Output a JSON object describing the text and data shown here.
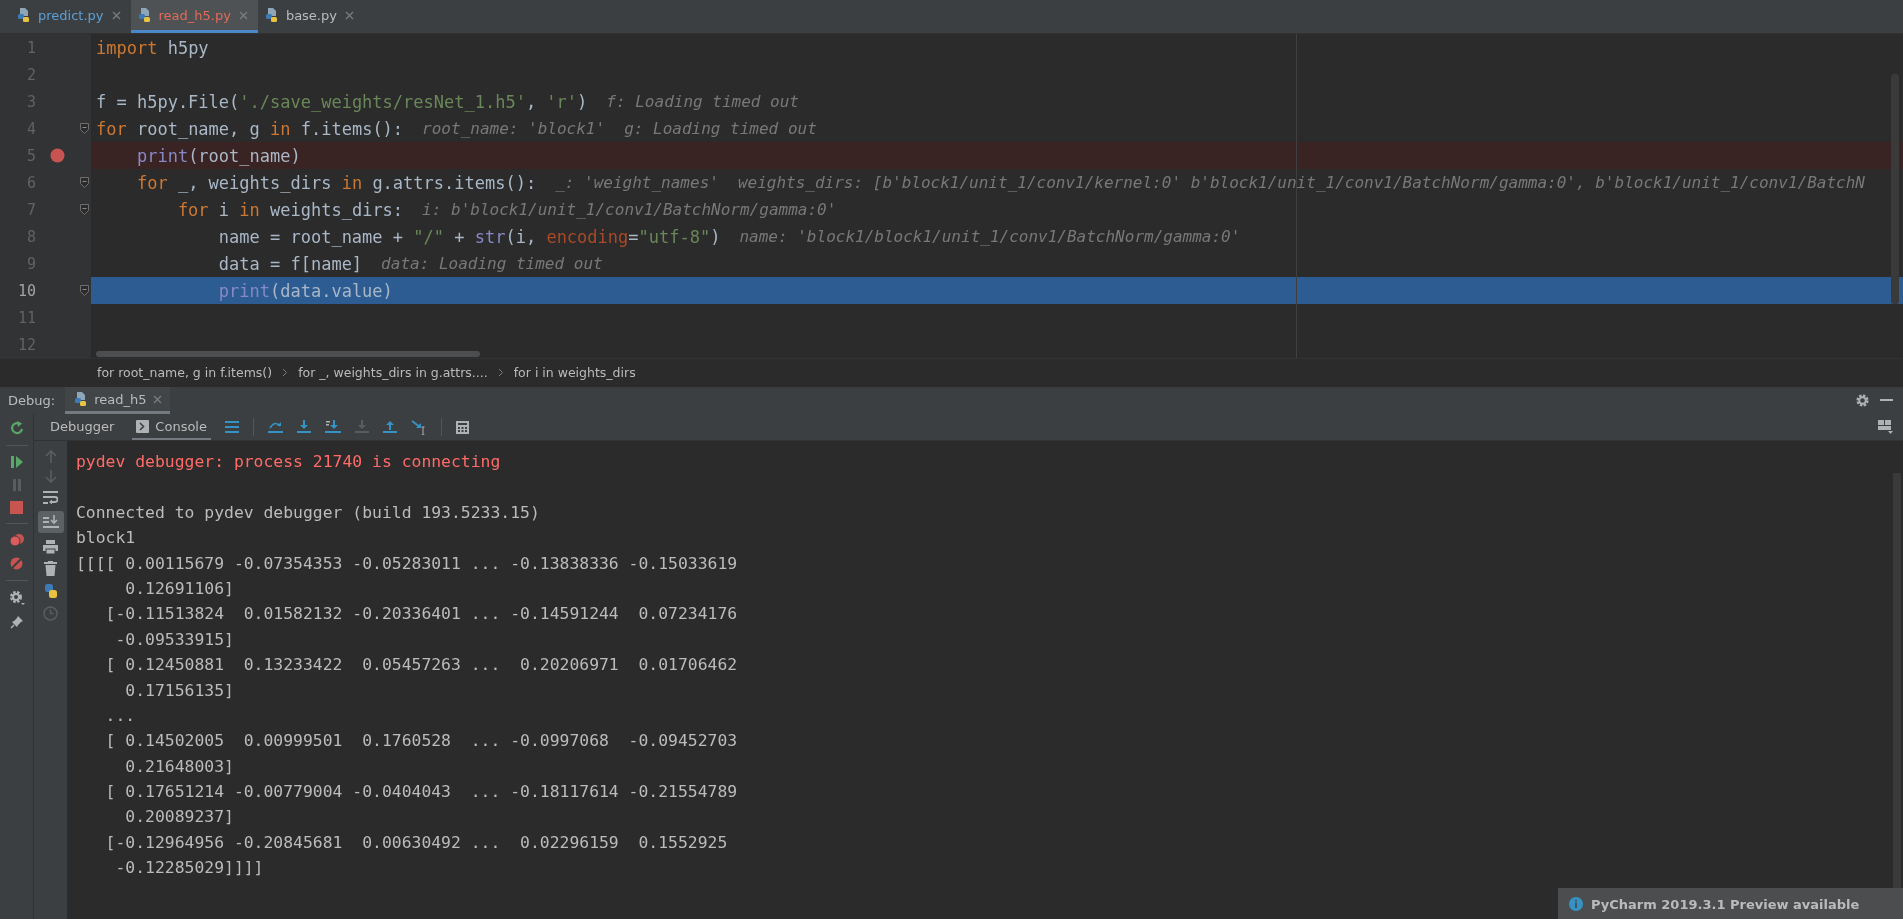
{
  "tabs": [
    {
      "label": "predict.py",
      "selected": false,
      "color": "#5c9fd6"
    },
    {
      "label": "read_h5.py",
      "selected": true,
      "color": "#e06c5a"
    },
    {
      "label": "base.py",
      "selected": false,
      "color": "#bbbbbb"
    }
  ],
  "editor": {
    "lines": [
      {
        "number": "1",
        "breakpoint": false,
        "current": false,
        "fold": false,
        "tokens": [
          {
            "kind": "keyword",
            "text": "import"
          },
          {
            "kind": "plain",
            "text": " h5py"
          }
        ]
      },
      {
        "number": "2",
        "breakpoint": false,
        "current": false,
        "fold": false
      },
      {
        "number": "3",
        "breakpoint": false,
        "current": false,
        "fold": false,
        "tokens": [
          {
            "kind": "plain",
            "text": "f = h5py.File("
          },
          {
            "kind": "string",
            "text": "'./save_weights/resNet_1.h5'"
          },
          {
            "kind": "plain",
            "text": ", "
          },
          {
            "kind": "string",
            "text": "'r'"
          },
          {
            "kind": "plain",
            "text": ")"
          }
        ],
        "hints": [
          "f: Loading timed out"
        ]
      },
      {
        "number": "4",
        "breakpoint": false,
        "current": false,
        "fold": true,
        "tokens": [
          {
            "kind": "keyword",
            "text": "for"
          },
          {
            "kind": "plain",
            "text": " root_name, g "
          },
          {
            "kind": "keyword",
            "text": "in"
          },
          {
            "kind": "plain",
            "text": " f.items():"
          }
        ],
        "hints": [
          "root_name: 'block1'",
          "g: Loading timed out"
        ]
      },
      {
        "number": "5",
        "breakpoint": true,
        "current": false,
        "fold": false,
        "tokens": [
          {
            "kind": "builtin",
            "text": "    print"
          },
          {
            "kind": "plain",
            "text": "(root_name)"
          }
        ]
      },
      {
        "number": "6",
        "breakpoint": false,
        "current": false,
        "fold": true,
        "tokens": [
          {
            "kind": "keyword",
            "text": "    for"
          },
          {
            "kind": "plain",
            "text": " _, weights_dirs "
          },
          {
            "kind": "keyword",
            "text": "in"
          },
          {
            "kind": "plain",
            "text": " g.attrs.items():"
          }
        ],
        "hints": [
          "_: 'weight_names'",
          "weights_dirs: [b'block1/unit_1/conv1/kernel:0' b'block1/unit_1/conv1/BatchNorm/gamma:0', b'block1/unit_1/conv1/BatchN"
        ]
      },
      {
        "number": "7",
        "breakpoint": false,
        "current": false,
        "fold": true,
        "tokens": [
          {
            "kind": "keyword",
            "text": "        for"
          },
          {
            "kind": "plain",
            "text": " i "
          },
          {
            "kind": "keyword",
            "text": "in"
          },
          {
            "kind": "plain",
            "text": " weights_dirs:"
          }
        ],
        "hints": [
          "i: b'block1/unit_1/conv1/BatchNorm/gamma:0'"
        ]
      },
      {
        "number": "8",
        "breakpoint": false,
        "current": false,
        "fold": false,
        "tokens": [
          {
            "kind": "plain",
            "text": "            name = root_name + "
          },
          {
            "kind": "string",
            "text": "\"/\""
          },
          {
            "kind": "plain",
            "text": " + "
          },
          {
            "kind": "builtin",
            "text": "str"
          },
          {
            "kind": "plain",
            "text": "(i, "
          },
          {
            "kind": "param",
            "text": "encoding"
          },
          {
            "kind": "plain",
            "text": "="
          },
          {
            "kind": "string",
            "text": "\"utf-8\""
          },
          {
            "kind": "plain",
            "text": ")"
          }
        ],
        "hints": [
          "name: 'block1/block1/unit_1/conv1/BatchNorm/gamma:0'"
        ]
      },
      {
        "number": "9",
        "breakpoint": false,
        "current": false,
        "fold": false,
        "tokens": [
          {
            "kind": "plain",
            "text": "            data = f[name]"
          }
        ],
        "hints": [
          "data: Loading timed out"
        ]
      },
      {
        "number": "10",
        "breakpoint": false,
        "current": true,
        "fold": true,
        "tokens": [
          {
            "kind": "builtin",
            "text": "            print"
          },
          {
            "kind": "plain",
            "text": "(data.value)"
          }
        ]
      },
      {
        "number": "11",
        "breakpoint": false,
        "current": false,
        "fold": false
      },
      {
        "number": "12",
        "breakpoint": false,
        "current": false,
        "fold": false
      }
    ]
  },
  "breadcrumbs": [
    "for root_name, g in f.items()",
    "for _, weights_dirs in g.attrs....",
    "for i in weights_dirs"
  ],
  "debug": {
    "label": "Debug:",
    "session_tabs": [
      {
        "label": "read_h5",
        "selected": true
      }
    ],
    "view_tabs": [
      {
        "label": "Debugger",
        "selected": false
      },
      {
        "label": "Console",
        "selected": true
      }
    ]
  },
  "console": [
    {
      "kind": "error",
      "text": "pydev debugger: process 21740 is connecting"
    },
    {
      "kind": "blank"
    },
    {
      "kind": "output",
      "text": "Connected to pydev debugger (build 193.5233.15)"
    },
    {
      "kind": "output",
      "text": "block1"
    },
    {
      "kind": "output",
      "text": "[[[[ 0.00115679 -0.07354353 -0.05283011 ... -0.13838336 -0.15033619"
    },
    {
      "kind": "output",
      "text": "     0.12691106]"
    },
    {
      "kind": "output",
      "text": "   [-0.11513824  0.01582132 -0.20336401 ... -0.14591244  0.07234176"
    },
    {
      "kind": "output",
      "text": "    -0.09533915]"
    },
    {
      "kind": "output",
      "text": "   [ 0.12450881  0.13233422  0.05457263 ...  0.20206971  0.01706462"
    },
    {
      "kind": "output",
      "text": "     0.17156135]"
    },
    {
      "kind": "output",
      "text": "   ..."
    },
    {
      "kind": "output",
      "text": "   [ 0.14502005  0.00999501  0.1760528  ... -0.0997068  -0.09452703"
    },
    {
      "kind": "output",
      "text": "     0.21648003]"
    },
    {
      "kind": "output",
      "text": "   [ 0.17651214 -0.00779004 -0.0404043  ... -0.18117614 -0.21554789"
    },
    {
      "kind": "output",
      "text": "     0.20089237]"
    },
    {
      "kind": "output",
      "text": "   [-0.12964956 -0.20845681  0.00630492 ...  0.02296159  0.1552925"
    },
    {
      "kind": "output",
      "text": "    -0.12285029]]]]"
    }
  ],
  "notification": {
    "title": "PyCharm 2019.3.1 Preview available"
  }
}
